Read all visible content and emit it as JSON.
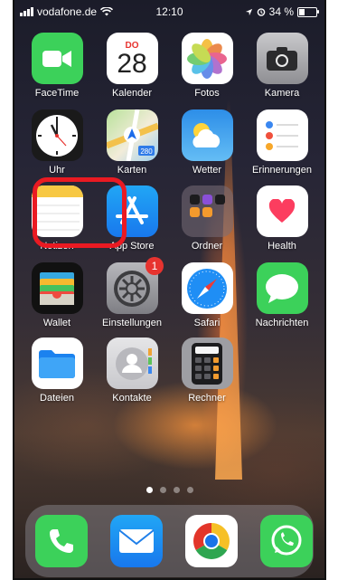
{
  "status_bar": {
    "carrier": "vodafone.de",
    "time": "12:10",
    "battery_percent": 34,
    "battery_label": "34 %"
  },
  "home": {
    "apps": [
      {
        "id": "facetime",
        "label": "FaceTime"
      },
      {
        "id": "kalender",
        "label": "Kalender",
        "weekday": "DO",
        "day": "28"
      },
      {
        "id": "fotos",
        "label": "Fotos"
      },
      {
        "id": "kamera",
        "label": "Kamera"
      },
      {
        "id": "uhr",
        "label": "Uhr"
      },
      {
        "id": "karten",
        "label": "Karten",
        "route_number": "280"
      },
      {
        "id": "wetter",
        "label": "Wetter"
      },
      {
        "id": "erinnerungen",
        "label": "Erinnerungen"
      },
      {
        "id": "notizen",
        "label": "Notizen"
      },
      {
        "id": "appstore",
        "label": "App Store"
      },
      {
        "id": "ordner",
        "label": "Ordner"
      },
      {
        "id": "health",
        "label": "Health"
      },
      {
        "id": "wallet",
        "label": "Wallet"
      },
      {
        "id": "einstellungen",
        "label": "Einstellungen",
        "badge": "1"
      },
      {
        "id": "safari",
        "label": "Safari"
      },
      {
        "id": "nachrichten",
        "label": "Nachrichten"
      },
      {
        "id": "dateien",
        "label": "Dateien"
      },
      {
        "id": "kontakte",
        "label": "Kontakte"
      },
      {
        "id": "rechner",
        "label": "Rechner"
      }
    ],
    "page_count": 4,
    "current_page": 1,
    "highlighted_app": "notizen",
    "highlight_color": "#ea1a22"
  },
  "dock": {
    "apps": [
      {
        "id": "telefon",
        "icon": "phone-icon"
      },
      {
        "id": "mail",
        "icon": "mail-icon"
      },
      {
        "id": "chrome",
        "icon": "chrome-icon"
      },
      {
        "id": "whatsapp",
        "icon": "whatsapp-icon"
      }
    ]
  }
}
